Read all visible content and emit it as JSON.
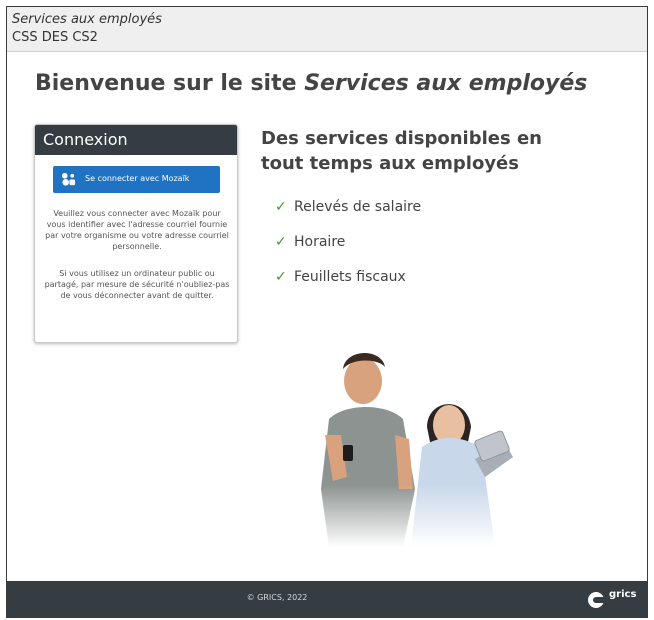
{
  "header": {
    "app_name": "Services aux employés",
    "org_name": "CSS DES CS2"
  },
  "welcome": {
    "prefix": "Bienvenue sur le site ",
    "site_name": "Services aux employés"
  },
  "login": {
    "title": "Connexion",
    "button_label": "Se connecter avec Mozaïk",
    "instructions": "Veuillez vous connecter avec Mozaïk pour vous identifier avec l'adresse courriel fournie par votre organisme ou votre adresse courriel personnelle.",
    "security_note": "Si vous utilisez un ordinateur public ou partagé, par mesure de sécurité n'oubliez-pas de vous déconnecter avant de quitter."
  },
  "services": {
    "title": "Des services disponibles en tout temps aux employés",
    "items": [
      {
        "label": "Relevés de salaire"
      },
      {
        "label": "Horaire"
      },
      {
        "label": "Feuillets fiscaux"
      }
    ]
  },
  "footer": {
    "copyright": "© GRICS, 2022",
    "logo_text": "grics"
  },
  "colors": {
    "header_bg": "#efefef",
    "dark_bar": "#353d43",
    "button_blue": "#1f73c2",
    "check_green": "#3f9a2a"
  },
  "icons": {
    "login_button_icon": "mozaik-icon",
    "check_icon": "check-icon",
    "logo_icon": "grics-logo-icon"
  }
}
